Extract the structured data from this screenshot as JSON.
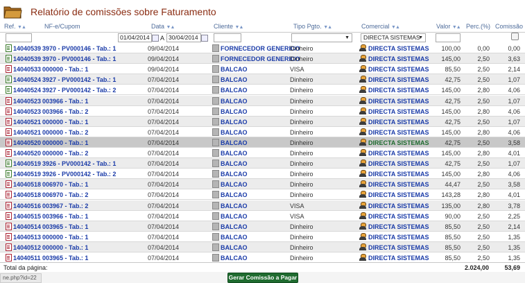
{
  "page": {
    "title": "Relatório de comissões sobre Faturamento"
  },
  "columns": {
    "ref": "Ref.",
    "nf": "NF-e/Cupom",
    "data": "Data",
    "cliente": "Cliente",
    "tipo": "Tipo Pgto.",
    "comercial": "Comercial",
    "valor": "Valor",
    "perc": "Perc.(%)",
    "comissao": "Comissão"
  },
  "filters": {
    "date_from": "01/04/2014",
    "date_sep": "A",
    "date_to": "30/04/2014",
    "comercial_selected": "DIRECTA SISTEMAS"
  },
  "rows": [
    {
      "ref": "14040539",
      "nf": "3970 - PV000146 - Tab.: 1",
      "data": "09/04/2014",
      "cliente": "FORNECEDOR GENERICO",
      "tipo": "Dinheiro",
      "comercial": "DIRECTA SISTEMAS",
      "valor": "100,00",
      "perc": "0,00",
      "comissao": "0,00",
      "icon": "green"
    },
    {
      "ref": "14040539",
      "nf": "3970 - PV000146 - Tab.: 1",
      "data": "09/04/2014",
      "cliente": "FORNECEDOR GENERICO",
      "tipo": "Dinheiro",
      "comercial": "DIRECTA SISTEMAS",
      "valor": "145,00",
      "perc": "2,50",
      "comissao": "3,63",
      "icon": "green"
    },
    {
      "ref": "14040533",
      "nf": "000000 - Tab.: 1",
      "data": "09/04/2014",
      "cliente": "BALCAO",
      "tipo": "VISA",
      "comercial": "DIRECTA SISTEMAS",
      "valor": "85,50",
      "perc": "2,50",
      "comissao": "2,14",
      "icon": "red"
    },
    {
      "ref": "14040524",
      "nf": "3927 - PV000142 - Tab.: 1",
      "data": "07/04/2014",
      "cliente": "BALCAO",
      "tipo": "Dinheiro",
      "comercial": "DIRECTA SISTEMAS",
      "valor": "42,75",
      "perc": "2,50",
      "comissao": "1,07",
      "icon": "green"
    },
    {
      "ref": "14040524",
      "nf": "3927 - PV000142 - Tab.: 2",
      "data": "07/04/2014",
      "cliente": "BALCAO",
      "tipo": "Dinheiro",
      "comercial": "DIRECTA SISTEMAS",
      "valor": "145,00",
      "perc": "2,80",
      "comissao": "4,06",
      "icon": "green"
    },
    {
      "ref": "14040523",
      "nf": "003966 - Tab.: 1",
      "data": "07/04/2014",
      "cliente": "BALCAO",
      "tipo": "Dinheiro",
      "comercial": "DIRECTA SISTEMAS",
      "valor": "42,75",
      "perc": "2,50",
      "comissao": "1,07",
      "icon": "red"
    },
    {
      "ref": "14040523",
      "nf": "003966 - Tab.: 2",
      "data": "07/04/2014",
      "cliente": "BALCAO",
      "tipo": "Dinheiro",
      "comercial": "DIRECTA SISTEMAS",
      "valor": "145,00",
      "perc": "2,80",
      "comissao": "4,06",
      "icon": "red"
    },
    {
      "ref": "14040521",
      "nf": "000000 - Tab.: 1",
      "data": "07/04/2014",
      "cliente": "BALCAO",
      "tipo": "Dinheiro",
      "comercial": "DIRECTA SISTEMAS",
      "valor": "42,75",
      "perc": "2,50",
      "comissao": "1,07",
      "icon": "red"
    },
    {
      "ref": "14040521",
      "nf": "000000 - Tab.: 2",
      "data": "07/04/2014",
      "cliente": "BALCAO",
      "tipo": "Dinheiro",
      "comercial": "DIRECTA SISTEMAS",
      "valor": "145,00",
      "perc": "2,80",
      "comissao": "4,06",
      "icon": "red"
    },
    {
      "ref": "14040520",
      "nf": "000000 - Tab.: 1",
      "data": "07/04/2014",
      "cliente": "BALCAO",
      "tipo": "Dinheiro",
      "comercial": "DIRECTA SISTEMAS",
      "valor": "42,75",
      "perc": "2,50",
      "comissao": "3,58",
      "icon": "red",
      "highlight": true
    },
    {
      "ref": "14040520",
      "nf": "000000 - Tab.: 2",
      "data": "07/04/2014",
      "cliente": "BALCAO",
      "tipo": "Dinheiro",
      "comercial": "DIRECTA SISTEMAS",
      "valor": "145,00",
      "perc": "2,80",
      "comissao": "4,01",
      "icon": "red"
    },
    {
      "ref": "14040519",
      "nf": "3926 - PV000142 - Tab.: 1",
      "data": "07/04/2014",
      "cliente": "BALCAO",
      "tipo": "Dinheiro",
      "comercial": "DIRECTA SISTEMAS",
      "valor": "42,75",
      "perc": "2,50",
      "comissao": "1,07",
      "icon": "green"
    },
    {
      "ref": "14040519",
      "nf": "3926 - PV000142 - Tab.: 2",
      "data": "07/04/2014",
      "cliente": "BALCAO",
      "tipo": "Dinheiro",
      "comercial": "DIRECTA SISTEMAS",
      "valor": "145,00",
      "perc": "2,80",
      "comissao": "4,06",
      "icon": "green"
    },
    {
      "ref": "14040518",
      "nf": "006970 - Tab.: 1",
      "data": "07/04/2014",
      "cliente": "BALCAO",
      "tipo": "Dinheiro",
      "comercial": "DIRECTA SISTEMAS",
      "valor": "44,47",
      "perc": "2,50",
      "comissao": "3,58",
      "icon": "red"
    },
    {
      "ref": "14040518",
      "nf": "006970 - Tab.: 2",
      "data": "07/04/2014",
      "cliente": "BALCAO",
      "tipo": "Dinheiro",
      "comercial": "DIRECTA SISTEMAS",
      "valor": "143,28",
      "perc": "2,80",
      "comissao": "4,01",
      "icon": "red"
    },
    {
      "ref": "14040516",
      "nf": "003967 - Tab.: 2",
      "data": "07/04/2014",
      "cliente": "BALCAO",
      "tipo": "VISA",
      "comercial": "DIRECTA SISTEMAS",
      "valor": "135,00",
      "perc": "2,80",
      "comissao": "3,78",
      "icon": "red"
    },
    {
      "ref": "14040515",
      "nf": "003966 - Tab.: 1",
      "data": "07/04/2014",
      "cliente": "BALCAO",
      "tipo": "VISA",
      "comercial": "DIRECTA SISTEMAS",
      "valor": "90,00",
      "perc": "2,50",
      "comissao": "2,25",
      "icon": "red"
    },
    {
      "ref": "14040514",
      "nf": "003965 - Tab.: 1",
      "data": "07/04/2014",
      "cliente": "BALCAO",
      "tipo": "Dinheiro",
      "comercial": "DIRECTA SISTEMAS",
      "valor": "85,50",
      "perc": "2,50",
      "comissao": "2,14",
      "icon": "red"
    },
    {
      "ref": "14040513",
      "nf": "000000 - Tab.: 1",
      "data": "07/04/2014",
      "cliente": "BALCAO",
      "tipo": "Dinheiro",
      "comercial": "DIRECTA SISTEMAS",
      "valor": "85,50",
      "perc": "2,50",
      "comissao": "1,35",
      "icon": "red"
    },
    {
      "ref": "14040512",
      "nf": "000000 - Tab.: 1",
      "data": "07/04/2014",
      "cliente": "BALCAO",
      "tipo": "Dinheiro",
      "comercial": "DIRECTA SISTEMAS",
      "valor": "85,50",
      "perc": "2,50",
      "comissao": "1,35",
      "icon": "red"
    },
    {
      "ref": "14040511",
      "nf": "003965 - Tab.: 1",
      "data": "07/04/2014",
      "cliente": "BALCAO",
      "tipo": "Dinheiro",
      "comercial": "DIRECTA SISTEMAS",
      "valor": "85,50",
      "perc": "2,50",
      "comissao": "1,35",
      "icon": "red"
    }
  ],
  "footer": {
    "label": "Total da página:",
    "total_valor": "2.024,00",
    "total_comissao": "53,69"
  },
  "actions": {
    "generate_label": "Gerar Comissão a Pagar"
  },
  "statusbar": {
    "url": "ne.php?id=22"
  }
}
